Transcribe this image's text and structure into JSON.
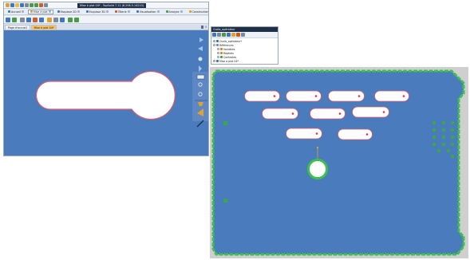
{
  "app": {
    "window_title": "Mise à plat 04* - TopSolid 7.11 (6.206.5.14210)",
    "ribbon_tabs": [
      {
        "label": "Accueil",
        "color": "#3e76c2"
      },
      {
        "label": "Mise à plat",
        "color": "#e2a030",
        "active": true
      },
      {
        "label": "Esquisse 2D",
        "color": "#3e76c2"
      },
      {
        "label": "Esquisse 3D",
        "color": "#3e76c2"
      },
      {
        "label": "Tôlerie",
        "color": "#d25a2a"
      },
      {
        "label": "Visualisation",
        "color": "#3e76c2"
      },
      {
        "label": "Analyse",
        "color": "#4a9a4a"
      },
      {
        "label": "Construction",
        "color": "#e2a030"
      },
      {
        "label": "Outils",
        "color": "#7a7a7a"
      }
    ],
    "doc_tabs": [
      {
        "label": "Page d'accueil",
        "active": false
      },
      {
        "label": "Mise à plat 04*",
        "active": true
      }
    ]
  },
  "panel": {
    "title": "Outils_opérateur",
    "tree": [
      {
        "label": "Outils_opérateur*",
        "depth": 0,
        "icon_color": "#3a6fc0"
      },
      {
        "label": "Références",
        "depth": 0,
        "icon_color": "#7a8a9c"
      },
      {
        "label": "Variables",
        "depth": 1,
        "icon_color": "#c98a2a"
      },
      {
        "label": "Repères",
        "depth": 1,
        "icon_color": "#c98a2a"
      },
      {
        "label": "Contextes",
        "depth": 1,
        "icon_color": "#4a9a4a"
      },
      {
        "label": "Mise à plat 04*",
        "depth": 0,
        "icon_color": "#3a6fc0"
      }
    ]
  },
  "colors": {
    "viewport_blue": "#4a7bbd",
    "part_outline": "#e05a6a",
    "plate_border_green": "#3ec14a",
    "clamp_green": "#3aa84a",
    "background_gray": "#cfcfcf"
  }
}
